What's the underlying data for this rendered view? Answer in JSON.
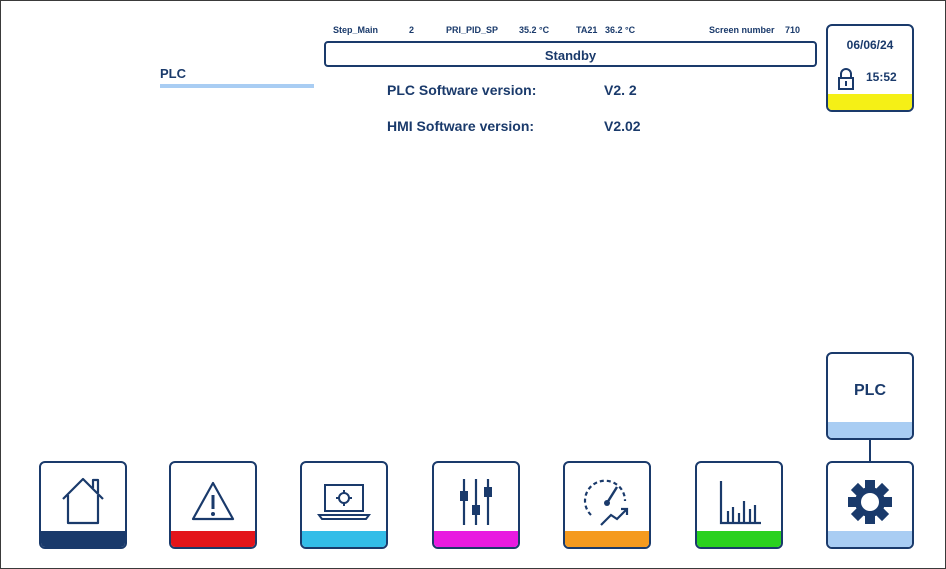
{
  "header": {
    "step_main_label": "Step_Main",
    "step_main_value": "2",
    "pri_pid_sp_label": "PRI_PID_SP",
    "pri_pid_sp_value": "35.2 °C",
    "ta21_label": "TA21",
    "ta21_value": "36.2 °C",
    "screen_number_label": "Screen number",
    "screen_number_value": "710",
    "state": "Standby"
  },
  "page": {
    "title": "PLC"
  },
  "info": {
    "plc_label": "PLC Software version:",
    "plc_value": "V2. 2",
    "hmi_label": "HMI Software version:",
    "hmi_value": "V2.02"
  },
  "clock": {
    "date": "06/06/24",
    "time": "15:52",
    "icon": "lock-icon",
    "accent": "#f5f016"
  },
  "side_button": {
    "label": "PLC",
    "accent": "#a9cdf3"
  },
  "nav": [
    {
      "icon": "home-icon",
      "accent": "#1a3a6b"
    },
    {
      "icon": "warning-icon",
      "accent": "#e3151b"
    },
    {
      "icon": "laptop-settings-icon",
      "accent": "#33bde8"
    },
    {
      "icon": "sliders-icon",
      "accent": "#e81be0"
    },
    {
      "icon": "gauge-trend-icon",
      "accent": "#f59a1e"
    },
    {
      "icon": "bar-chart-icon",
      "accent": "#2ad11f"
    },
    {
      "icon": "gear-icon",
      "accent": "#a9cdf3"
    }
  ]
}
